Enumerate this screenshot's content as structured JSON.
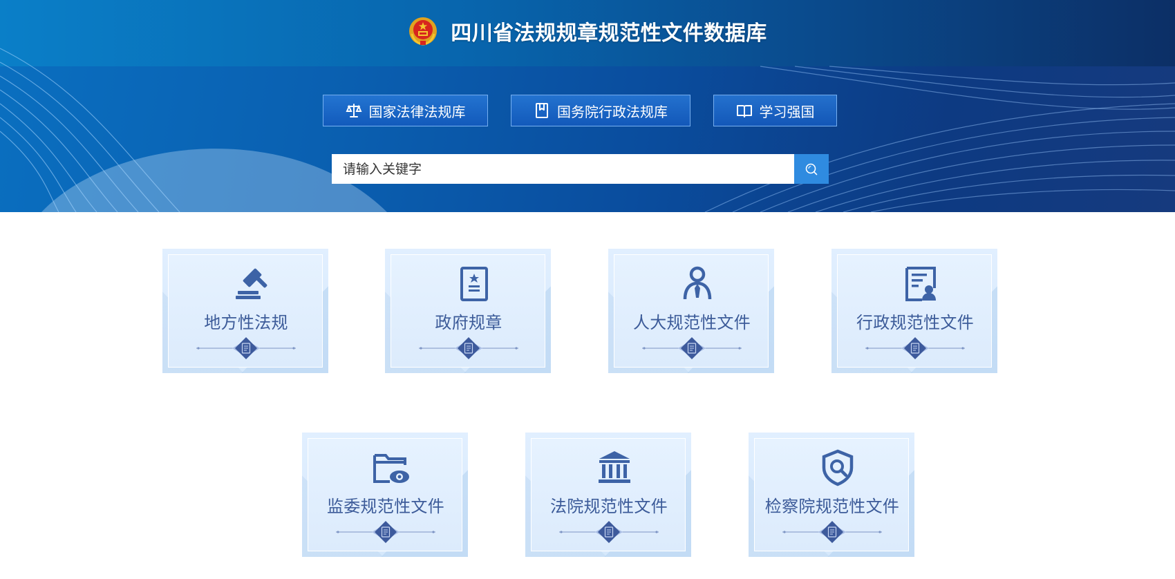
{
  "header": {
    "site_title": "四川省法规规章规范性文件数据库"
  },
  "quick_links": [
    {
      "label": "国家法律法规库",
      "icon": "scales-icon"
    },
    {
      "label": "国务院行政法规库",
      "icon": "bookmark-book-icon"
    },
    {
      "label": "学习强国",
      "icon": "open-book-icon"
    }
  ],
  "search": {
    "placeholder": "请输入关键字",
    "value": "",
    "button_icon": "search-icon"
  },
  "categories": [
    {
      "label": "地方性法规",
      "icon": "gavel-icon"
    },
    {
      "label": "政府规章",
      "icon": "document-badge-icon"
    },
    {
      "label": "人大规范性文件",
      "icon": "person-tie-icon"
    },
    {
      "label": "行政规范性文件",
      "icon": "certificate-icon"
    },
    {
      "label": "监委规范性文件",
      "icon": "folder-eye-icon"
    },
    {
      "label": "法院规范性文件",
      "icon": "courthouse-icon"
    },
    {
      "label": "检察院规范性文件",
      "icon": "shield-search-icon"
    }
  ],
  "colors": {
    "banner_primary": "#0a5fb0",
    "card_text": "#3c5b99",
    "icon_blue": "#3d63a6",
    "search_button": "#2f8be0"
  }
}
